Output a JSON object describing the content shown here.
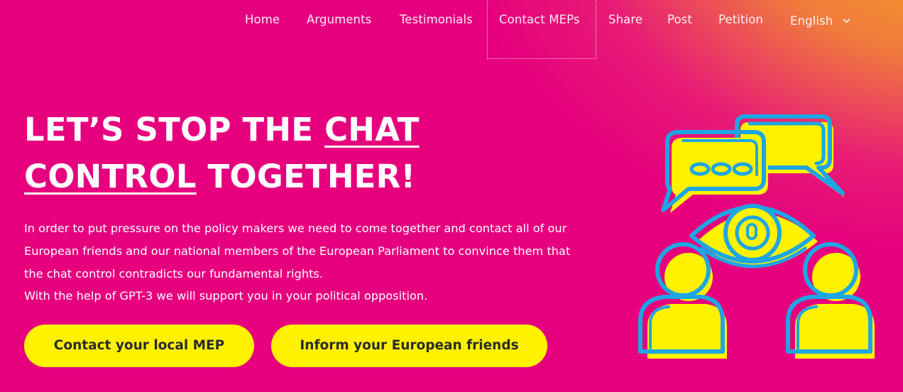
{
  "nav": {
    "items": [
      {
        "label": "Home"
      },
      {
        "label": "Arguments"
      },
      {
        "label": "Testimonials"
      },
      {
        "label": "Contact MEPs"
      },
      {
        "label": "Share"
      },
      {
        "label": "Post"
      },
      {
        "label": "Petition"
      }
    ],
    "language": {
      "label": "English",
      "icon": "chevron-down-icon"
    }
  },
  "hero": {
    "headline": {
      "part1": "LET’S STOP THE ",
      "emph1": "CHAT",
      "emph2": "CONTROL",
      "part2": " TOGETHER!"
    },
    "paragraph1": "In order to put pressure on the policy makers we need to come together and contact all of our European friends and our national members of the European Parliament to convince them that the chat control contradicts our fundamental rights.",
    "paragraph2": "With the help of GPT-3 we will support you in your political opposition.",
    "buttons": {
      "contact_mep": "Contact your local MEP",
      "inform_friends": "Inform your European friends"
    },
    "illustration": {
      "icon": "surveillance-chat-illustration",
      "colors": {
        "outline": "#1ea6e3",
        "fill": "#fff200"
      }
    }
  },
  "colors": {
    "background": "#e6007e",
    "gradient_corner": "#f6a81a",
    "button": "#fff200",
    "button_text": "#2a2a2a",
    "text": "#ffffff"
  }
}
